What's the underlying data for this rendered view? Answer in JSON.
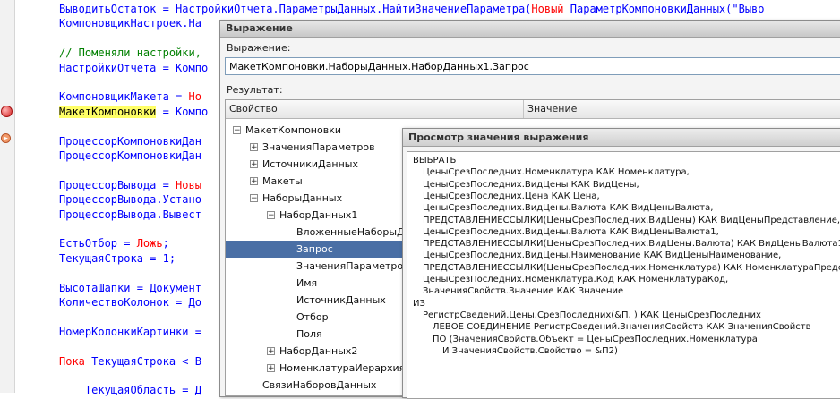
{
  "code": {
    "lines": [
      {
        "parts": [
          {
            "t": "ВыводитьОстаток = НастройкиОтчета.ПараметрыДанных.НайтиЗначениеПараметра(",
            "c": "v"
          },
          {
            "t": "Новый ",
            "c": "k"
          },
          {
            "t": "ПараметрКомпоновкиДанных(\"Выво",
            "c": "v"
          }
        ]
      },
      {
        "parts": [
          {
            "t": "КомпоновщикНастроек.На",
            "c": "v"
          }
        ]
      },
      {
        "parts": []
      },
      {
        "parts": [
          {
            "t": "// Поменяли настройки,",
            "c": "c"
          }
        ]
      },
      {
        "parts": [
          {
            "t": "НастройкиОтчета = Компо",
            "c": "v"
          }
        ]
      },
      {
        "parts": []
      },
      {
        "parts": [
          {
            "t": "КомпоновщикМакета = ",
            "c": "v"
          },
          {
            "t": "Но",
            "c": "k"
          }
        ]
      },
      {
        "parts": [
          {
            "t": "МакетКомпоновки",
            "c": "hl"
          },
          {
            "t": " = Компо",
            "c": "v"
          }
        ]
      },
      {
        "parts": []
      },
      {
        "parts": [
          {
            "t": "ПроцессорКомпоновкиДан",
            "c": "v"
          }
        ]
      },
      {
        "parts": [
          {
            "t": "ПроцессорКомпоновкиДан",
            "c": "v"
          }
        ]
      },
      {
        "parts": []
      },
      {
        "parts": [
          {
            "t": "ПроцессорВывода = ",
            "c": "v"
          },
          {
            "t": "Новы",
            "c": "k"
          }
        ]
      },
      {
        "parts": [
          {
            "t": "ПроцессорВывода.Устано",
            "c": "v"
          }
        ]
      },
      {
        "parts": [
          {
            "t": "ПроцессорВывода.Вывест",
            "c": "v"
          }
        ]
      },
      {
        "parts": []
      },
      {
        "parts": [
          {
            "t": "ЕстьОтбор = ",
            "c": "v"
          },
          {
            "t": "Ложь",
            "c": "k"
          },
          {
            "t": ";",
            "c": "v"
          }
        ]
      },
      {
        "parts": [
          {
            "t": "ТекущаяСтрока = 1;",
            "c": "v"
          }
        ]
      },
      {
        "parts": []
      },
      {
        "parts": [
          {
            "t": "ВысотаШапки = Документ",
            "c": "v"
          }
        ]
      },
      {
        "parts": [
          {
            "t": "КоличествоКолонок = До",
            "c": "v"
          }
        ]
      },
      {
        "parts": []
      },
      {
        "parts": [
          {
            "t": "НомерКолонкиКартинки =",
            "c": "v"
          }
        ]
      },
      {
        "parts": []
      },
      {
        "parts": [
          {
            "t": "Пока ",
            "c": "k"
          },
          {
            "t": "ТекущаяСтрока < В",
            "c": "v"
          }
        ]
      },
      {
        "parts": []
      },
      {
        "parts": [
          {
            "t": "    ТекущаяОбласть = Д",
            "c": "v"
          }
        ]
      }
    ]
  },
  "expression_dialog": {
    "title": "Выражение",
    "expression_label": "Выражение:",
    "expression_value": "МакетКомпоновки.НаборыДанных.НаборДанных1.Запрос",
    "result_label": "Результат:",
    "columns": {
      "property": "Свойство",
      "value": "Значение"
    },
    "tree": [
      {
        "label": "МакетКомпоновки",
        "level": 0,
        "expander": "minus"
      },
      {
        "label": "ЗначенияПараметров",
        "level": 1,
        "expander": "plus"
      },
      {
        "label": "ИсточникиДанных",
        "level": 1,
        "expander": "plus"
      },
      {
        "label": "Макеты",
        "level": 1,
        "expander": "plus"
      },
      {
        "label": "НаборыДанных",
        "level": 1,
        "expander": "minus"
      },
      {
        "label": "НаборДанных1",
        "level": 2,
        "expander": "minus"
      },
      {
        "label": "ВложенныеНаборыДанных",
        "level": 3,
        "expander": "none"
      },
      {
        "label": "Запрос",
        "level": 3,
        "expander": "none",
        "selected": true
      },
      {
        "label": "ЗначенияПараметров",
        "level": 3,
        "expander": "none"
      },
      {
        "label": "Имя",
        "level": 3,
        "expander": "none"
      },
      {
        "label": "ИсточникДанных",
        "level": 3,
        "expander": "none"
      },
      {
        "label": "Отбор",
        "level": 3,
        "expander": "none"
      },
      {
        "label": "Поля",
        "level": 3,
        "expander": "none"
      },
      {
        "label": "НаборДанных2",
        "level": 2,
        "expander": "plus"
      },
      {
        "label": "НоменклатураИерархия",
        "level": 2,
        "expander": "plus"
      },
      {
        "label": "СвязиНаборовДанных",
        "level": 1,
        "expander": "none"
      }
    ]
  },
  "value_dialog": {
    "title": "Просмотр значения выражения",
    "query_lines": [
      {
        "text": "ВЫБРАТЬ",
        "indent": 0
      },
      {
        "text": "ЦеныСрезПоследних.Номенклатура КАК Номенклатура,",
        "indent": 1
      },
      {
        "text": "ЦеныСрезПоследних.ВидЦены КАК ВидЦены,",
        "indent": 1
      },
      {
        "text": "ЦеныСрезПоследних.Цена КАК Цена,",
        "indent": 1
      },
      {
        "text": "ЦеныСрезПоследних.ВидЦены.Валюта КАК ВидЦеныВалюта,",
        "indent": 1
      },
      {
        "text": "ПРЕДСТАВЛЕНИЕССЫЛКИ(ЦеныСрезПоследних.ВидЦены) КАК ВидЦеныПредставление,",
        "indent": 1
      },
      {
        "text": "ЦеныСрезПоследних.ВидЦены.Валюта КАК ВидЦеныВалюта1,",
        "indent": 1
      },
      {
        "text": "ПРЕДСТАВЛЕНИЕССЫЛКИ(ЦеныСрезПоследних.ВидЦены.Валюта) КАК ВидЦеныВалюта1",
        "indent": 1
      },
      {
        "text": "ЦеныСрезПоследних.ВидЦены.Наименование КАК ВидЦеныНаименование,",
        "indent": 1
      },
      {
        "text": "ПРЕДСТАВЛЕНИЕССЫЛКИ(ЦеныСрезПоследних.Номенклатура) КАК НоменклатураПредс",
        "indent": 1
      },
      {
        "text": "ЦеныСрезПоследних.Номенклатура.Код КАК НоменклатураКод,",
        "indent": 1
      },
      {
        "text": "ЗначенияСвойств.Значение КАК Значение",
        "indent": 1
      },
      {
        "text": "ИЗ",
        "indent": 0
      },
      {
        "text": "РегистрСведений.Цены.СрезПоследних(&П, ) КАК ЦеныСрезПоследних",
        "indent": 1
      },
      {
        "text": "ЛЕВОЕ СОЕДИНЕНИЕ РегистрСведений.ЗначенияСвойств КАК ЗначенияСвойств",
        "indent": 2
      },
      {
        "text": "ПО (ЗначенияСвойств.Объект = ЦеныСрезПоследних.Номенклатура",
        "indent": 2
      },
      {
        "text": "И ЗначенияСвойств.Свойство = &П2)",
        "indent": 3
      }
    ]
  }
}
